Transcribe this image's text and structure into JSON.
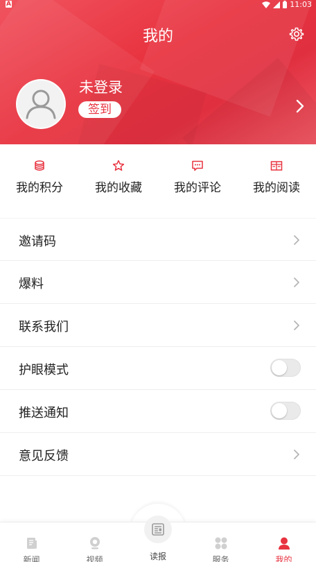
{
  "status_bar": {
    "time": "11:03",
    "notification_icon": "A"
  },
  "header": {
    "title": "我的",
    "username": "未登录",
    "signin_label": "签到"
  },
  "quick_links": [
    {
      "label": "我的积分",
      "icon": "coins-icon"
    },
    {
      "label": "我的收藏",
      "icon": "star-icon"
    },
    {
      "label": "我的评论",
      "icon": "comment-icon"
    },
    {
      "label": "我的阅读",
      "icon": "book-icon"
    }
  ],
  "menu": [
    {
      "label": "邀请码",
      "control": "chevron"
    },
    {
      "label": "爆料",
      "control": "chevron"
    },
    {
      "label": "联系我们",
      "control": "chevron"
    },
    {
      "label": "护眼模式",
      "control": "toggle",
      "on": false
    },
    {
      "label": "推送通知",
      "control": "toggle",
      "on": false
    },
    {
      "label": "意见反馈",
      "control": "chevron"
    }
  ],
  "tabbar": {
    "tabs": [
      "新闻",
      "视频",
      "读报",
      "服务",
      "我的"
    ],
    "active": "我的"
  },
  "colors": {
    "accent": "#e8323f",
    "header_gradient_start": "#f0545f"
  }
}
